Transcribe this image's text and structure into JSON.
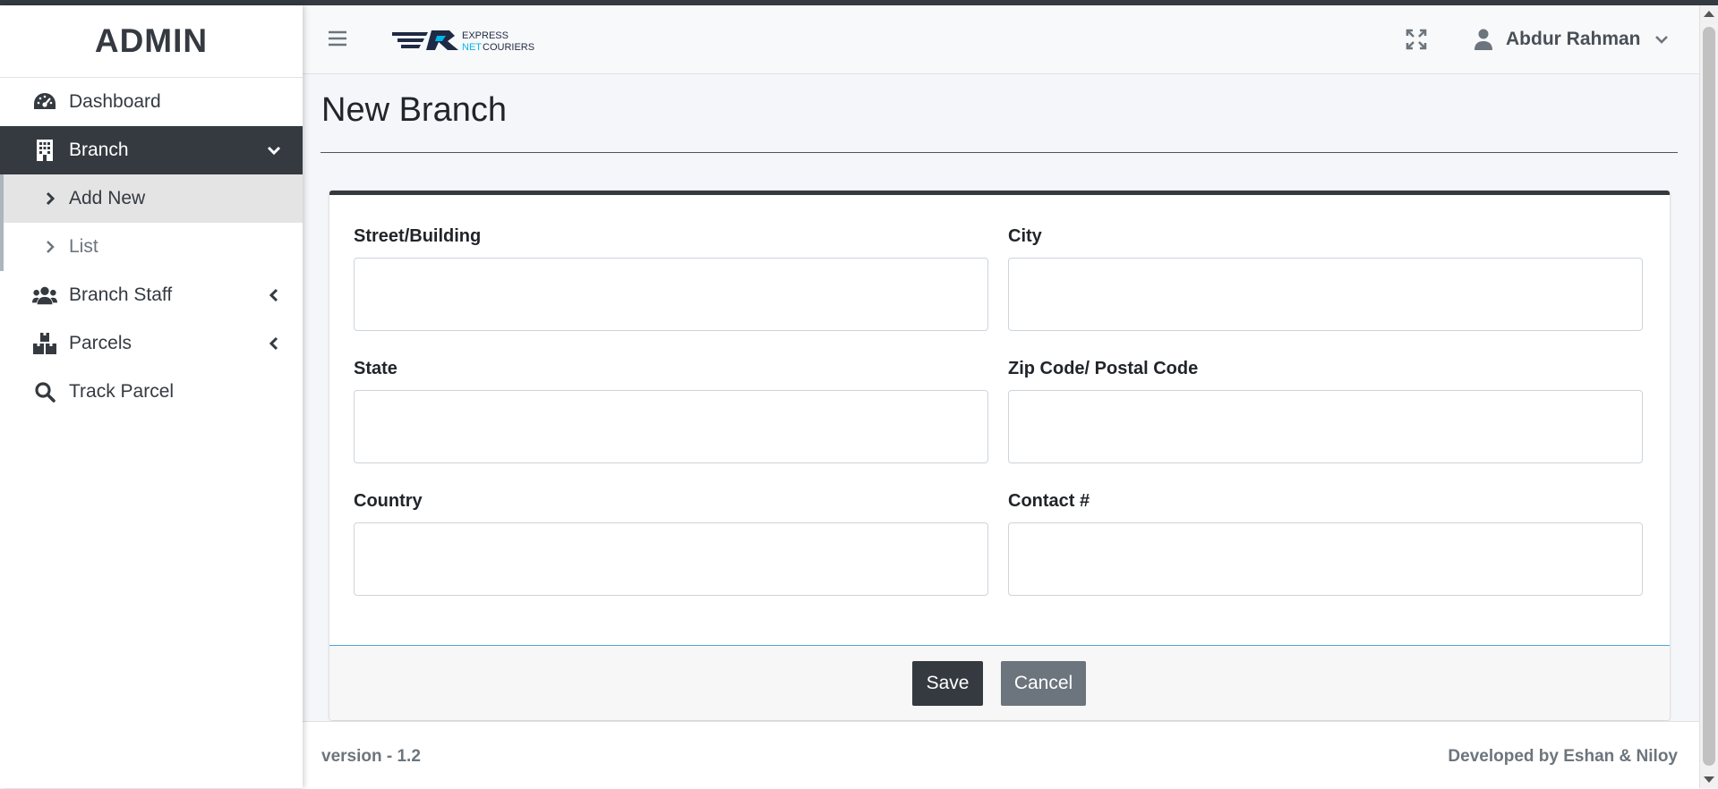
{
  "sidebar": {
    "brand": "ADMIN",
    "items": [
      {
        "label": "Dashboard",
        "icon": "tachometer-icon"
      },
      {
        "label": "Branch",
        "icon": "building-icon",
        "active": true
      },
      {
        "label": "Add New",
        "icon": "chevron-right-icon",
        "sub": true,
        "current": true
      },
      {
        "label": "List",
        "icon": "chevron-right-icon",
        "sub": true
      },
      {
        "label": "Branch Staff",
        "icon": "users-icon"
      },
      {
        "label": "Parcels",
        "icon": "boxes-icon"
      },
      {
        "label": "Track Parcel",
        "icon": "search-icon"
      }
    ]
  },
  "header": {
    "logo_text_top": "EXPRESS",
    "logo_text_mid": "NET",
    "logo_text_bottom": "COURIERS",
    "user_name": "Abdur Rahman"
  },
  "page": {
    "title": "New Branch"
  },
  "form": {
    "fields": [
      {
        "label": "Street/Building",
        "value": ""
      },
      {
        "label": "City",
        "value": ""
      },
      {
        "label": "State",
        "value": ""
      },
      {
        "label": "Zip Code/ Postal Code",
        "value": ""
      },
      {
        "label": "Country",
        "value": ""
      },
      {
        "label": "Contact #",
        "value": ""
      }
    ],
    "save_label": "Save",
    "cancel_label": "Cancel"
  },
  "footer": {
    "version": "version - 1.2",
    "developed_by": "Developed by Eshan & Niloy"
  },
  "colors": {
    "dark": "#343a40",
    "secondary": "#6c757d",
    "footer_accent": "#4ba6d6",
    "logo_cyan": "#00b7eb"
  }
}
